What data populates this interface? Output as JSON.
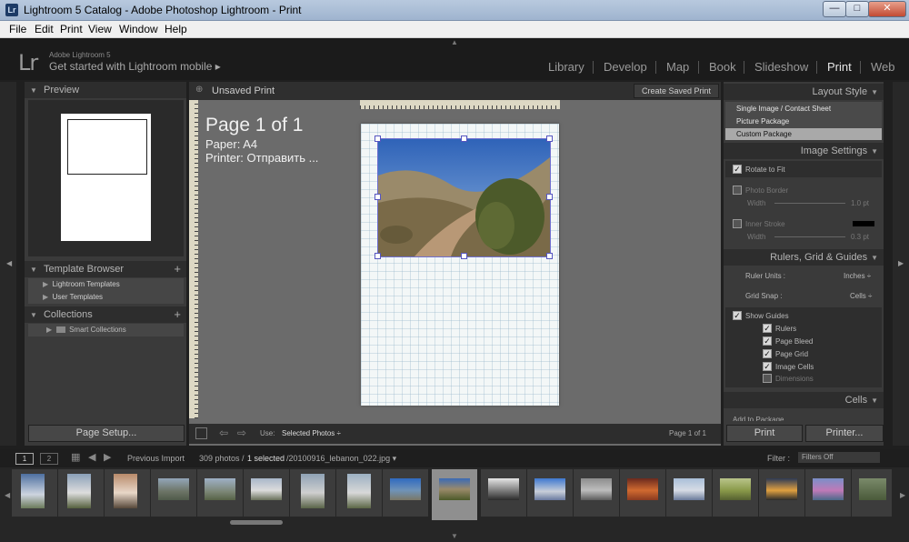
{
  "window": {
    "title": "Lightroom 5 Catalog - Adobe Photoshop Lightroom - Print",
    "app_icon_text": "Lr",
    "buttons": {
      "minimize": "—",
      "maximize": "□",
      "close": "✕"
    }
  },
  "menu": [
    {
      "label": "File"
    },
    {
      "label": "Edit"
    },
    {
      "label": "Print"
    },
    {
      "label": "View"
    },
    {
      "label": "Window"
    },
    {
      "label": "Help"
    }
  ],
  "identity": {
    "logo": "Lr",
    "version": "Adobe Lightroom 5",
    "mobile_link": "Get started with Lightroom mobile ▸"
  },
  "modules": [
    {
      "label": "Library"
    },
    {
      "label": "Develop"
    },
    {
      "label": "Map"
    },
    {
      "label": "Book"
    },
    {
      "label": "Slideshow"
    },
    {
      "label": "Print",
      "active": true
    },
    {
      "label": "Web"
    }
  ],
  "left_panel": {
    "preview_title": "Preview",
    "template_browser_title": "Template Browser",
    "template_items": [
      "Lightroom Templates",
      "User Templates"
    ],
    "collections_title": "Collections",
    "collection_items": [
      "Smart Collections"
    ],
    "page_setup_label": "Page Setup..."
  },
  "center": {
    "title": "Unsaved Print",
    "create_saved_label": "Create Saved Print",
    "page_info": "Page 1 of 1",
    "paper": "Paper:  A4",
    "printer": "Printer:  Отправить ...",
    "use_label": "Use:",
    "use_value": "Selected Photos ÷",
    "page_count": "Page 1 of 1"
  },
  "right_panel": {
    "layout_style_title": "Layout Style",
    "layout_options": [
      {
        "label": "Single Image / Contact Sheet"
      },
      {
        "label": "Picture Package"
      },
      {
        "label": "Custom Package",
        "selected": true
      }
    ],
    "image_settings_title": "Image Settings",
    "rotate_to_fit": "Rotate to Fit",
    "photo_border": "Photo Border",
    "inner_stroke": "Inner Stroke",
    "width_label": "Width",
    "border_width_value": "1.0 pt",
    "stroke_width_value": "0.3 pt",
    "rulers_title": "Rulers, Grid & Guides",
    "ruler_units_label": "Ruler Units :",
    "ruler_units_value": "Inches ÷",
    "grid_snap_label": "Grid Snap :",
    "grid_snap_value": "Cells ÷",
    "show_guides": "Show Guides",
    "guides": [
      {
        "label": "Rulers",
        "checked": true
      },
      {
        "label": "Page Bleed",
        "checked": true
      },
      {
        "label": "Page Grid",
        "checked": true
      },
      {
        "label": "Image Cells",
        "checked": true
      },
      {
        "label": "Dimensions",
        "checked": false
      }
    ],
    "cells_title": "Cells",
    "add_to_package": "Add to Package",
    "print_label": "Print",
    "printer_label": "Printer..."
  },
  "filmstrip": {
    "screen1": "1",
    "screen2": "2",
    "source": "Previous Import",
    "count": "309 photos /",
    "selected": "1 selected",
    "filename": "/20100916_lebanon_022.jpg ▾",
    "filter_label": "Filter :",
    "filter_value": "Filters Off"
  },
  "colors": {
    "accent": "#e6e6e6",
    "panel": "#3a3a3a",
    "selection": "#8f8f8f"
  }
}
